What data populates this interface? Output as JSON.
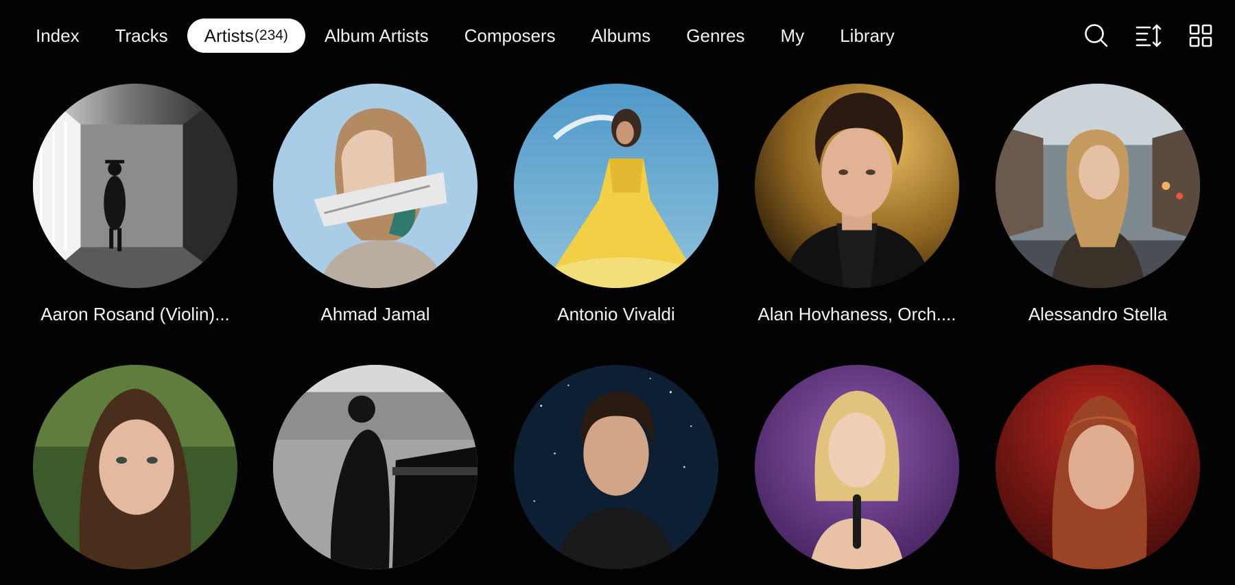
{
  "tabs": [
    {
      "label": "Index"
    },
    {
      "label": "Tracks"
    },
    {
      "label": "Artists",
      "count": "(234)",
      "active": true
    },
    {
      "label": "Album Artists"
    },
    {
      "label": "Composers"
    },
    {
      "label": "Albums"
    },
    {
      "label": "Genres"
    },
    {
      "label": "My"
    },
    {
      "label": "Library"
    }
  ],
  "toolbar": {
    "icons": [
      "search-icon",
      "sort-icon",
      "grid-view-icon"
    ]
  },
  "artists": [
    {
      "name": "Aaron Rosand (Violin)...",
      "image": "man walking in corridor, black and white"
    },
    {
      "name": "Ahmad Jamal",
      "image": "woman profile with silver paint on face, blue background"
    },
    {
      "name": "Antonio Vivaldi",
      "image": "woman in yellow dress, blue sky"
    },
    {
      "name": "Alan Hovhaness, Orch....",
      "image": "man portrait, gold background"
    },
    {
      "name": "Alessandro Stella",
      "image": "woman in leather jacket, city street"
    },
    {
      "name": "",
      "image": "woman portrait, green background"
    },
    {
      "name": "",
      "image": "pianist silhouette at grand piano"
    },
    {
      "name": "",
      "image": "man portrait, starry night sky"
    },
    {
      "name": "",
      "image": "blonde singer with microphone, purple background"
    },
    {
      "name": "",
      "image": "woman portrait, red background"
    }
  ],
  "colors": {
    "background": "#030303",
    "active_tab_bg": "#ffffff",
    "text": "#f4f4f4"
  }
}
